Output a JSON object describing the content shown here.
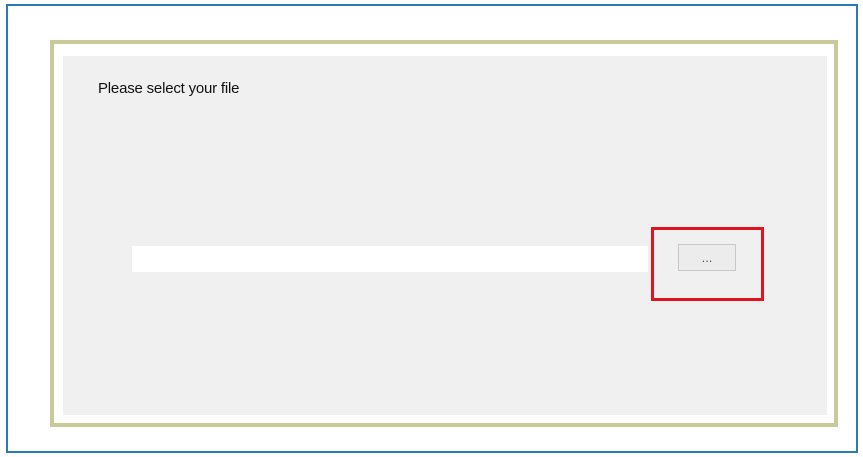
{
  "dialog": {
    "prompt_label": "Please select your file",
    "file_path_value": "",
    "browse_button_label": "..."
  },
  "colors": {
    "outer_frame_border": "#2a7ab8",
    "panel_border": "#c9c99a",
    "panel_background": "#f0f0f0",
    "highlight_box": "#e0141e"
  }
}
